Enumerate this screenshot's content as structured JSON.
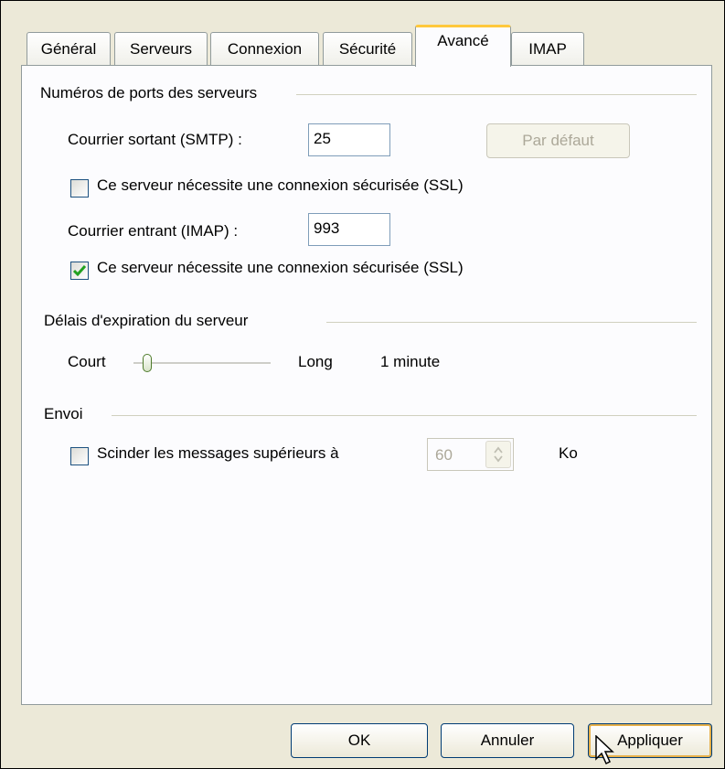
{
  "tabs": [
    {
      "label": "Général",
      "active": false
    },
    {
      "label": "Serveurs",
      "active": false
    },
    {
      "label": "Connexion",
      "active": false
    },
    {
      "label": "Sécurité",
      "active": false
    },
    {
      "label": "Avancé",
      "active": true
    },
    {
      "label": "IMAP",
      "active": false
    }
  ],
  "ports": {
    "group_title": "Numéros de ports des serveurs",
    "smtp_label": "Courrier sortant (SMTP) :",
    "smtp_value": "25",
    "default_button": "Par défaut",
    "smtp_ssl_label": "Ce serveur nécessite une connexion sécurisée (SSL)",
    "smtp_ssl_checked": false,
    "imap_label": "Courrier entrant (IMAP) :",
    "imap_value": "993",
    "imap_ssl_label": "Ce serveur nécessite une connexion sécurisée (SSL)",
    "imap_ssl_checked": true
  },
  "timeout": {
    "group_title": "Délais d'expiration du serveur",
    "short_label": "Court",
    "long_label": "Long",
    "value_label": "1 minute",
    "slider_level": 0.1
  },
  "sending": {
    "group_title": "Envoi",
    "split_label": "Scinder les messages supérieurs à",
    "split_checked": false,
    "split_value": "60",
    "unit": "Ko"
  },
  "buttons": {
    "ok": "OK",
    "cancel": "Annuler",
    "apply": "Appliquer"
  },
  "colors": {
    "active_tab_accent": "#ffc83c",
    "check_green": "#21a121"
  }
}
